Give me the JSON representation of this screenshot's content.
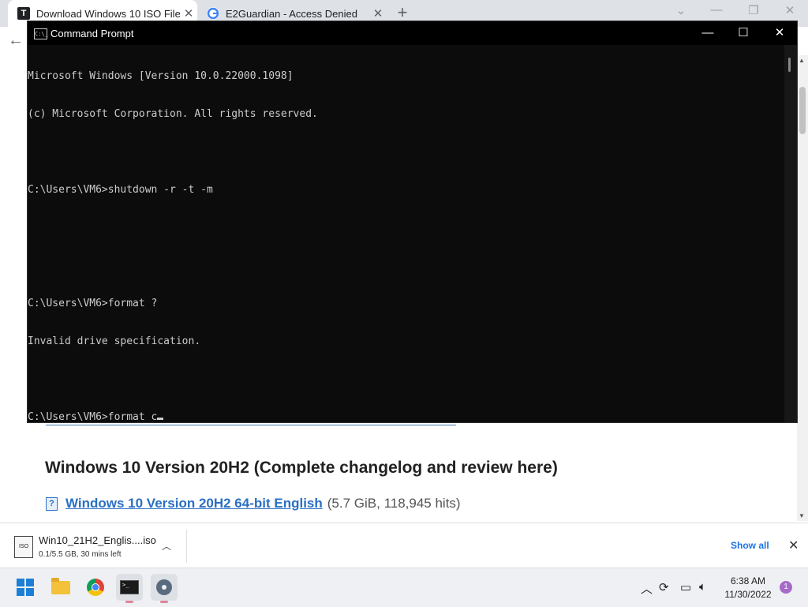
{
  "browser": {
    "tabs": [
      {
        "title": "Download Windows 10 ISO Files",
        "favicon": "T"
      },
      {
        "title": "E2Guardian - Access Denied",
        "favicon": "G"
      }
    ],
    "new_tab": "+",
    "page": {
      "heading": "Windows 10 Version 20H2 (Complete changelog and review here)",
      "link_text": "Windows 10 Version 20H2 64-bit English",
      "link_meta": "(5.7 GiB, 118,945 hits)",
      "icon": "?"
    }
  },
  "cmd": {
    "title": "Command Prompt",
    "icon_text": "C:\\_",
    "lines": [
      "Microsoft Windows [Version 10.0.22000.1098]",
      "(c) Microsoft Corporation. All rights reserved.",
      "",
      "C:\\Users\\VM6>shutdown -r -t -m",
      "",
      "",
      "C:\\Users\\VM6>format ?",
      "Invalid drive specification.",
      "",
      "C:\\Users\\VM6>format c"
    ]
  },
  "download_bar": {
    "file_name": "Win10_21H2_Englis....iso",
    "status": "0.1/5.5 GB, 30 mins left",
    "file_icon": "ISO",
    "show_all": "Show all"
  },
  "taskbar": {
    "time": "6:38 AM",
    "date": "11/30/2022",
    "notification_count": "1"
  },
  "colors": {
    "terminal_bg": "#0c0c0c",
    "terminal_text": "#cccccc",
    "link": "#2a6fc4",
    "accent": "#1a73e8"
  }
}
